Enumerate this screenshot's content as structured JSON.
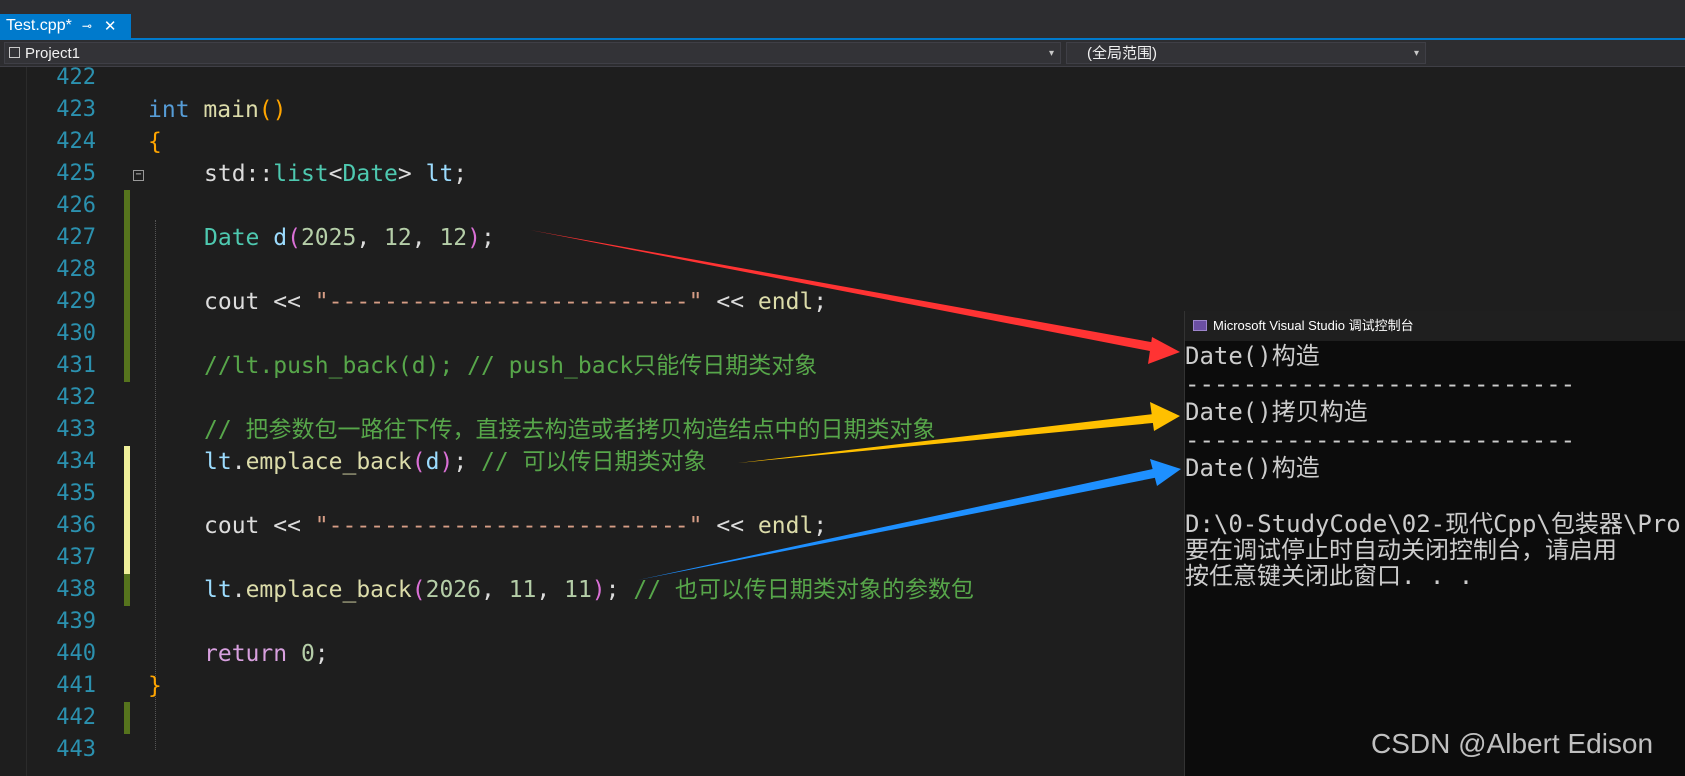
{
  "tab": {
    "title": "Test.cpp*",
    "pin": "⊸",
    "close": "✕"
  },
  "nav": {
    "project": "Project1",
    "scope": "(全局范围)",
    "arrow": "▾"
  },
  "lines": {
    "n422": "422",
    "n423": "423",
    "n424": "424",
    "n425": "425",
    "n426": "426",
    "n427": "427",
    "n428": "428",
    "n429": "429",
    "n430": "430",
    "n431": "431",
    "n432": "432",
    "n433": "433",
    "n434": "434",
    "n435": "435",
    "n436": "436",
    "n437": "437",
    "n438": "438",
    "n439": "439",
    "n440": "440",
    "n441": "441",
    "n442": "442",
    "n443": "443"
  },
  "code": {
    "l423_kw": "int",
    "l423_fn": "main",
    "l423_p": "()",
    "l424": "{",
    "l425_ns": "std",
    "l425_sep": "::",
    "l425_list": "list",
    "l425_lt": "<",
    "l425_date": "Date",
    "l425_gt": "> ",
    "l425_var": "lt",
    "l425_end": ";",
    "l427_type": "Date",
    "l427_var": " d",
    "l427_open": "(",
    "l427_n1": "2025",
    "l427_c1": ", ",
    "l427_n2": "12",
    "l427_c2": ", ",
    "l427_n3": "12",
    "l427_close": ")",
    "l427_end": ";",
    "l429_cout": "cout",
    "l429_op": " << ",
    "l429_str": "\"--------------------------\"",
    "l429_op2": " << ",
    "l429_endl": "endl",
    "l429_end": ";",
    "l431": "//lt.push_back(d); // push_back只能传日期类对象",
    "l433": "// 把参数包一路往下传，直接去构造或者拷贝构造结点中的日期类对象",
    "l434_var": "lt",
    "l434_dot": ".",
    "l434_fn": "emplace_back",
    "l434_open": "(",
    "l434_arg": "d",
    "l434_close": ")",
    "l434_end": "; ",
    "l434_com": "// 可以传日期类对象",
    "l436_cout": "cout",
    "l436_op": " << ",
    "l436_str": "\"--------------------------\"",
    "l436_op2": " << ",
    "l436_endl": "endl",
    "l436_end": ";",
    "l438_var": "lt",
    "l438_dot": ".",
    "l438_fn": "emplace_back",
    "l438_open": "(",
    "l438_n1": "2026",
    "l438_c1": ", ",
    "l438_n2": "11",
    "l438_c2": ", ",
    "l438_n3": "11",
    "l438_close": ")",
    "l438_end": "; ",
    "l438_com": "// 也可以传日期类对象的参数包",
    "l440_kw": "return",
    "l440_num": " 0",
    "l440_end": ";",
    "l441": "}"
  },
  "console": {
    "title": "Microsoft Visual Studio 调试控制台",
    "lines": [
      "Date()构造",
      "---------------------------",
      "Date()拷贝构造",
      "---------------------------",
      "Date()构造",
      "",
      "D:\\0-StudyCode\\02-现代Cpp\\包装器\\Pro",
      "要在调试停止时自动关闭控制台，请启用",
      "按任意键关闭此窗口. . ."
    ]
  },
  "watermark": "CSDN @Albert Edison",
  "colors": {
    "arrow_red": "#ff3333",
    "arrow_yellow": "#ffc000",
    "arrow_blue": "#1e90ff",
    "accent": "#007acc"
  }
}
